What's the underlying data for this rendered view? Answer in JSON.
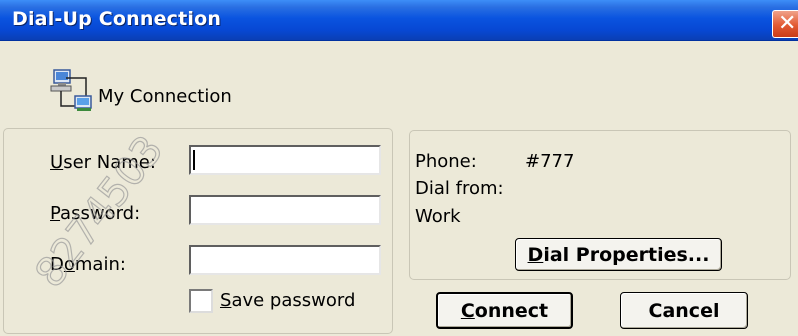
{
  "window": {
    "title": "Dial-Up Connection",
    "close_glyph": "✕"
  },
  "connection": {
    "name": "My Connection",
    "icon": "network-computers-icon"
  },
  "form": {
    "username": {
      "label_accel": "U",
      "label_rest": "ser Name:",
      "value": ""
    },
    "password": {
      "label_accel": "P",
      "label_rest": "assword:",
      "value": ""
    },
    "domain": {
      "label_pre": "D",
      "label_accel": "o",
      "label_rest": "main:",
      "value": ""
    },
    "save_password": {
      "label_accel": "S",
      "label_rest": "ave password",
      "checked": false
    }
  },
  "info": {
    "phone_label": "Phone:",
    "phone_value": "#777",
    "dial_from_label": "Dial from:",
    "dial_from_value": "Work"
  },
  "buttons": {
    "dial_properties": {
      "accel": "D",
      "rest": "ial Properties..."
    },
    "connect": {
      "accel": "C",
      "rest": "onnect"
    },
    "cancel": {
      "label": "Cancel"
    }
  },
  "watermark": {
    "text": "8274503"
  },
  "colors": {
    "titlebar": "#0a54e0",
    "dialog_bg": "#ece9d8",
    "close_button": "#e25a33"
  }
}
